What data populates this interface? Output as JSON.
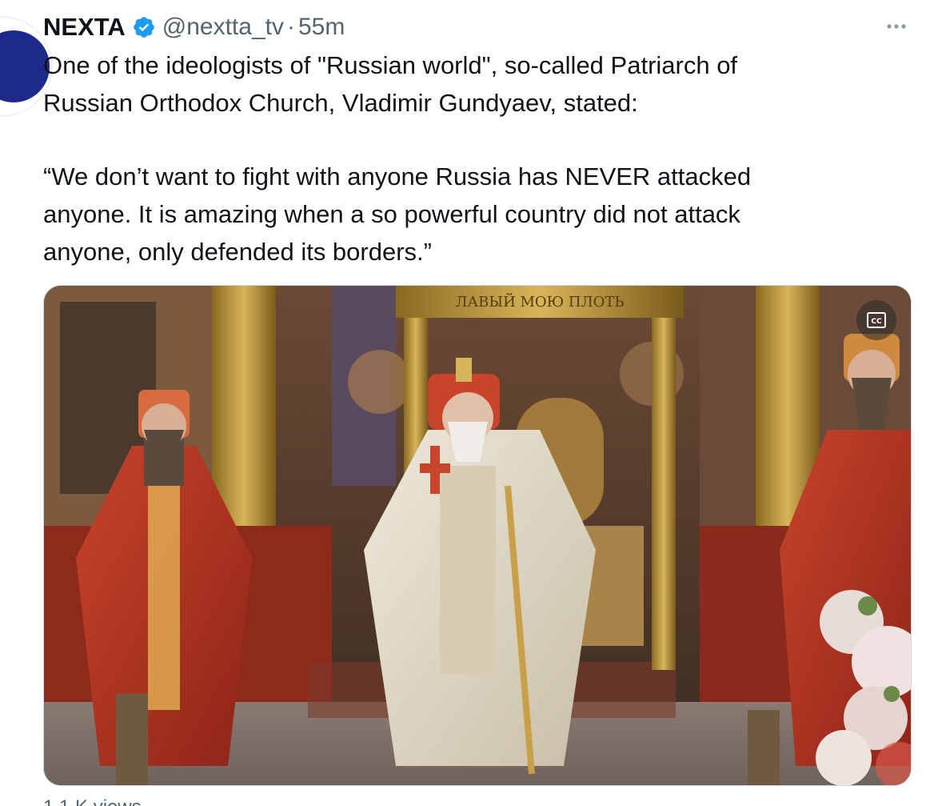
{
  "tweet": {
    "display_name": "NEXTA",
    "handle": "@nextta_tv",
    "separator": "·",
    "timestamp": "55m",
    "more_icon": "ellipsis-icon",
    "verified_icon": "verified-badge-icon",
    "text_paragraph_1": "One of the ideologists of \"Russian world\", so-called Patriarch of\nRussian Orthodox Church, Vladimir Gundyaev, stated:",
    "text_paragraph_2": "“We don’t want to fight with anyone Russia has NEVER attacked\nanyone. It is amazing when a so powerful country did not attack\nanyone, only defended its borders.”",
    "media": {
      "type": "video",
      "banner_text": "ЛАВЫЙ МОЮ ПЛОТЬ",
      "captions_icon": "closed-captions-icon"
    },
    "footer_partial": "1 1 K views"
  },
  "colors": {
    "verified_blue": "#1d9bf0",
    "secondary_text": "#536471",
    "primary_text": "#0f1419"
  }
}
